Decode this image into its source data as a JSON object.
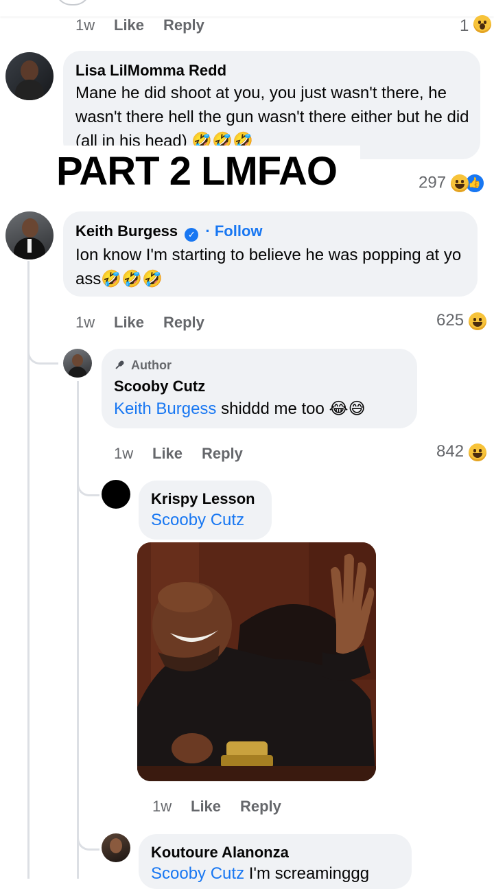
{
  "overlay_text": "PART 2 LMFAO",
  "top_comment": {
    "time": "1w",
    "like": "Like",
    "reply": "Reply",
    "reaction_count": "1",
    "reaction_emoji": "😮"
  },
  "lisa": {
    "name": "Lisa LilMomma Redd",
    "text": "Mane he did shoot at you, you just wasn't there, he wasn't there hell the gun wasn't there either but he did (all in his head) 🤣🤣🤣",
    "reaction_count": "297"
  },
  "keith": {
    "name": "Keith Burgess",
    "follow": "· Follow",
    "text": "Ion know I'm starting to believe he was popping at yo ass🤣🤣🤣",
    "time": "1w",
    "like": "Like",
    "reply": "Reply",
    "reaction_count": "625"
  },
  "scooby": {
    "badge": "Author",
    "name": "Scooby Cutz",
    "mention": "Keith Burgess",
    "text": " shiddd me too 😂😅",
    "time": "1w",
    "like": "Like",
    "reply": "Reply",
    "reaction_count": "842"
  },
  "krispy": {
    "name": "Krispy Lesson",
    "mention": "Scooby Cutz",
    "time": "1w",
    "like": "Like",
    "reply": "Reply"
  },
  "koutoure": {
    "name": "Koutoure Alanonza",
    "mention": "Scooby Cutz",
    "text": " I'm screaminggg"
  },
  "colors": {
    "bubble": "#f0f2f5",
    "link": "#1877f2",
    "meta": "#65676b",
    "thread": "#dcdfe4"
  }
}
